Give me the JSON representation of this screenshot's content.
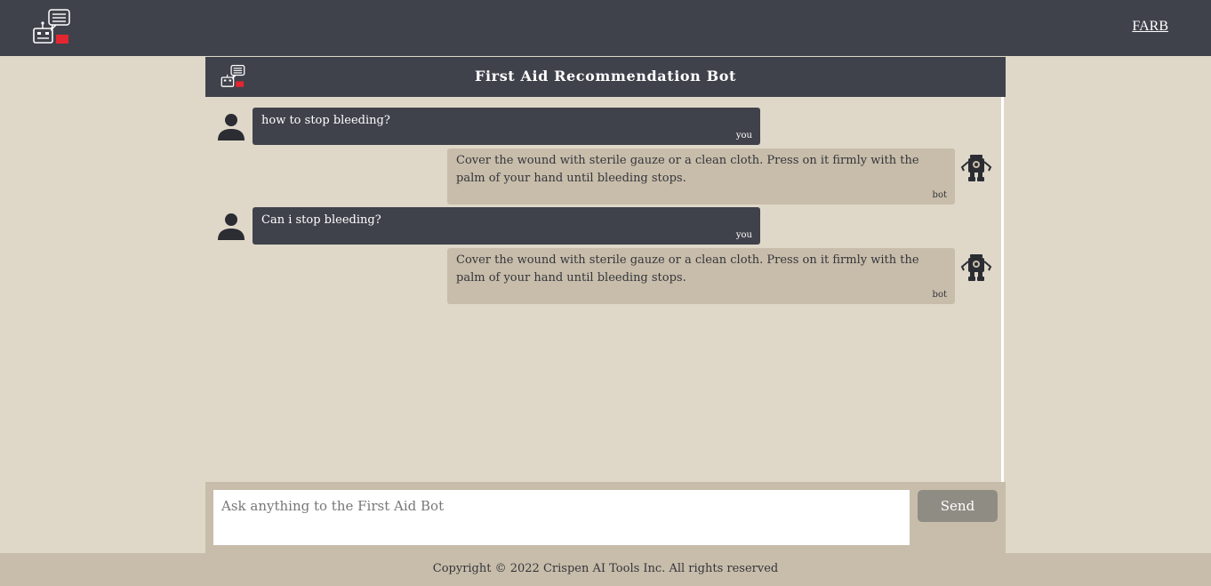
{
  "nav": {
    "logo_icon": "chatbot-logo-icon",
    "brand": "FARB"
  },
  "chat": {
    "title": "First Aid Recommendation Bot",
    "messages": [
      {
        "sender": "user",
        "text": "how to stop bleeding?",
        "label": "you"
      },
      {
        "sender": "bot",
        "text": "Cover the wound with sterile gauze or a clean cloth. Press on it firmly with the palm of your hand until bleeding stops.",
        "label": "bot"
      },
      {
        "sender": "user",
        "text": "Can i stop bleeding?",
        "label": "you"
      },
      {
        "sender": "bot",
        "text": "Cover the wound with sterile gauze or a clean cloth. Press on it firmly with the palm of your hand until bleeding stops.",
        "label": "bot"
      }
    ]
  },
  "composer": {
    "placeholder": "Ask anything to the First Aid Bot",
    "value": "",
    "send_label": "Send"
  },
  "footer": {
    "text": "Copyright © 2022 Crispen AI Tools Inc. All rights reserved"
  },
  "colors": {
    "header_bg": "#3f424b",
    "page_bg": "#dfd8c9",
    "bot_bubble": "#c8bdaa",
    "user_bubble": "#3f424b",
    "accent_red": "#e3262f",
    "send_button": "#8f8c84"
  }
}
